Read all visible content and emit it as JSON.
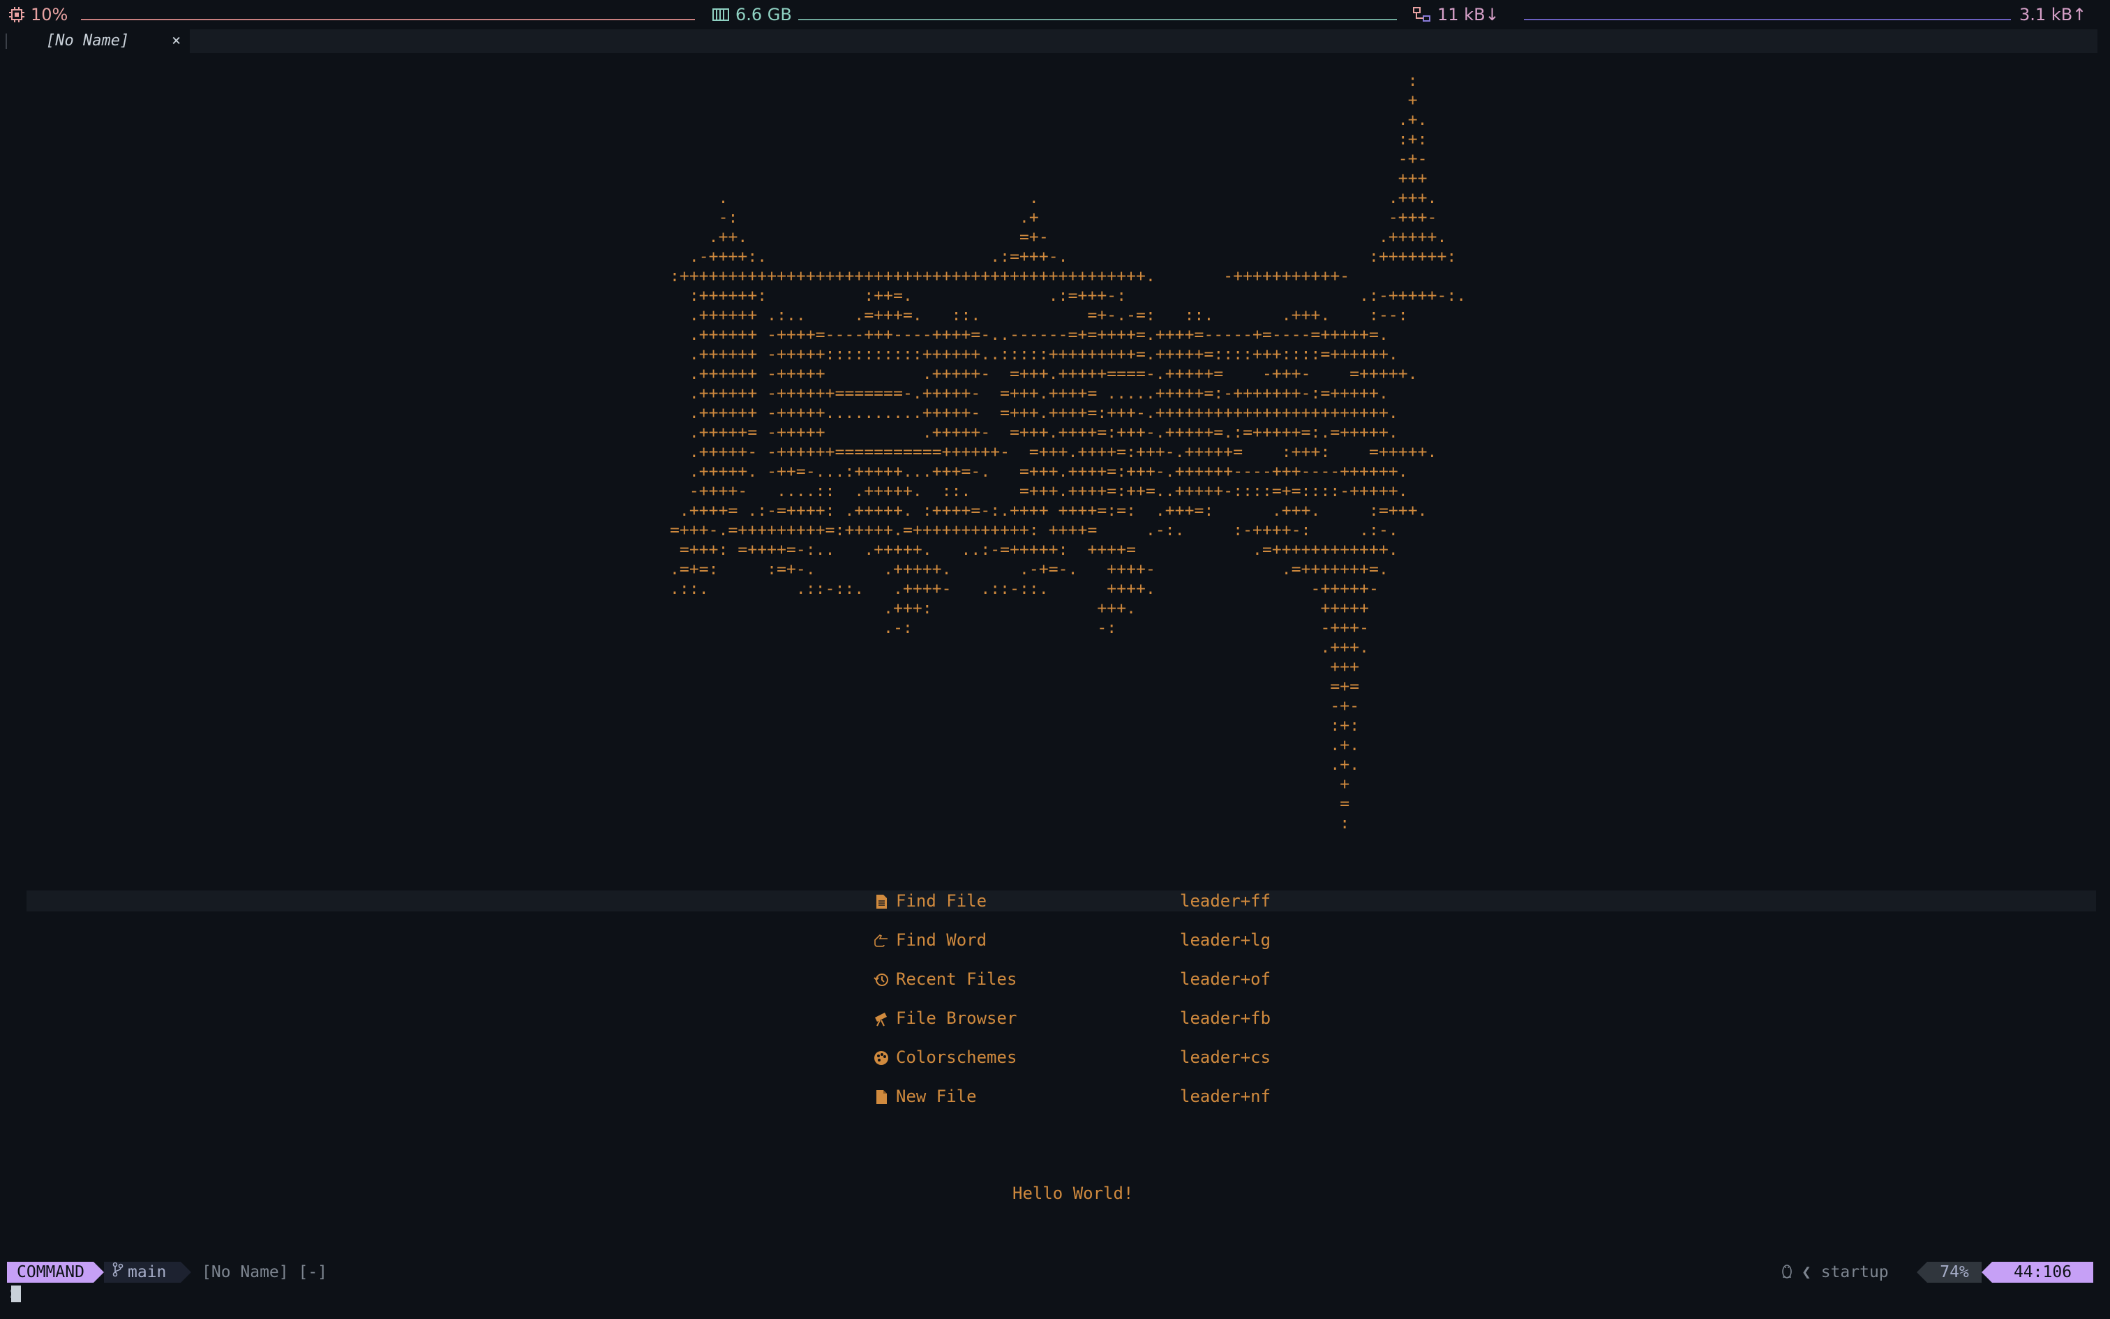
{
  "system_bar": {
    "cpu": "10%",
    "memory": "6.6 GB",
    "net_down": "11 kB↓",
    "net_up": "3.1 kB↑",
    "colors": {
      "cpu": "#e8a2a2",
      "memory": "#8fd1c2",
      "net": "#8a7bd8"
    }
  },
  "tabline": {
    "active_tab": "[No Name]",
    "close_glyph": "×"
  },
  "dashboard": {
    "ascii_art": "                                                                            :\n                                                                            +\n                                                                           .+.\n                                                                           :+:\n                                                                           -+-\n                                                                           +++\n     .                               .                                    .+++.\n     -:                             .+                                    -+++-\n    .++.                            =+-                                  .+++++.\n  .-++++:.                       .:=+++-.                               :+++++++:\n:++++++++++++++++++++++++++++++++++++++++++++++++.       -+++++++++++-\n  :++++++:          :++=.              .:=+++-:                        .:-+++++-:.\n  .++++++ .:..     .=+++=.   ::.           =+-.-=:   ::.       .+++.    :--:\n  .++++++ -++++=----+++----++++=-..------=+=++++=.++++=-----+=----=+++++=.\n  .++++++ -+++++::::::::::++++++..:::::+++++++++=.+++++=::::+++::::=++++++.\n  .++++++ -+++++          .+++++-  =+++.+++++====-.+++++=    -+++-    =+++++.\n  .++++++ -++++++=======-.+++++-  =+++.++++= .....+++++=:-+++++++-:=+++++.\n  .++++++ -+++++..........+++++-  =+++.++++=:+++-.++++++++++++++++++++++++.\n  .+++++= -+++++          .+++++-  =+++.++++=:+++-.+++++=.:=+++++=:.=+++++.\n  .+++++- -++++++===========++++++-  =+++.++++=:+++-.+++++=    :+++:    =+++++.\n  .+++++. -++=-...:+++++...+++=-.   =+++.++++=:+++-.++++++----+++----++++++.\n  -++++-   ....::  .+++++.  ::.     =+++.++++=:++=..+++++-::::=+=::::-+++++.\n .++++= .:-=++++: .+++++. :++++=-:.++++ ++++=:=:  .+++=:      .+++.     :=+++.\n=+++-.=+++++++++=:+++++.=++++++++++++: ++++=     .-:.     :-++++-:     .:-.\n =+++: =++++=-:..   .+++++.   ..:-=+++++:  ++++=            .=++++++++++++.\n.=+=:     :=+-.       .+++++.       .-+=-.   ++++-             .=+++++++=.\n.::.         .::-::.   .++++-   .::-::.      ++++.                -+++++-\n                      .+++:                 +++.                   +++++\n                      .-:                   -:                     -+++-\n                                                                   .+++.\n                                                                    +++\n                                                                    =+=\n                                                                    -+-\n                                                                    :+:\n                                                                    .+.\n                                                                    .+.\n                                                                     +\n                                                                     =\n                                                                     :",
    "menu": [
      {
        "label": "Find File",
        "shortcut": "leader+ff",
        "icon": "file-icon"
      },
      {
        "label": "Find Word",
        "shortcut": "leader+lg",
        "icon": "hand-pointer-icon"
      },
      {
        "label": "Recent Files",
        "shortcut": "leader+of",
        "icon": "history-icon"
      },
      {
        "label": "File Browser",
        "shortcut": "leader+fb",
        "icon": "telescope-icon"
      },
      {
        "label": "Colorschemes",
        "shortcut": "leader+cs",
        "icon": "palette-icon"
      },
      {
        "label": "New File",
        "shortcut": "leader+nf",
        "icon": "new-file-icon"
      }
    ],
    "footer": "Hello World!"
  },
  "statusline": {
    "mode": "COMMAND",
    "branch": "main",
    "file": "[No Name] [-]",
    "startup_label": "startup",
    "percent": "74%",
    "position": "44:106"
  },
  "cmdline": {
    "text": ":"
  }
}
